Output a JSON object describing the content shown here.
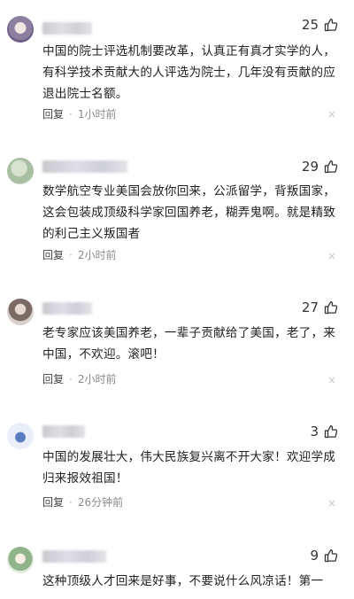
{
  "comments": [
    {
      "likes": "25",
      "text": "中国的院士评选机制要改革，认真正有真才实学的人，有科学技术贡献大的人评选为院士，几年没有贡献的应退出院士名额。",
      "reply": "回复",
      "dot": "·",
      "time": "1小时前",
      "close": "×"
    },
    {
      "likes": "29",
      "text": "数学航空专业美国会放你回来，公派留学，背叛国家，这会包装成顶级科学家回国养老，糊弄鬼啊。就是精致的利己主义叛国者",
      "reply": "回复",
      "dot": "·",
      "time": "2小时前",
      "close": "×"
    },
    {
      "likes": "27",
      "text": "老专家应该美国养老，一辈子贡献给了美国，老了，来中国，不欢迎。滚吧！",
      "reply": "回复",
      "dot": "·",
      "time": "2小时前",
      "close": "×"
    },
    {
      "likes": "3",
      "text": "中国的发展壮大，伟大民族复兴离不开大家！欢迎学成归来报效祖国！",
      "reply": "回复",
      "dot": "·",
      "time": "26分钟前",
      "close": "×"
    },
    {
      "likes": "9",
      "text": "这种顶级人才回来是好事，不要说什么风凉话！第一"
    }
  ]
}
